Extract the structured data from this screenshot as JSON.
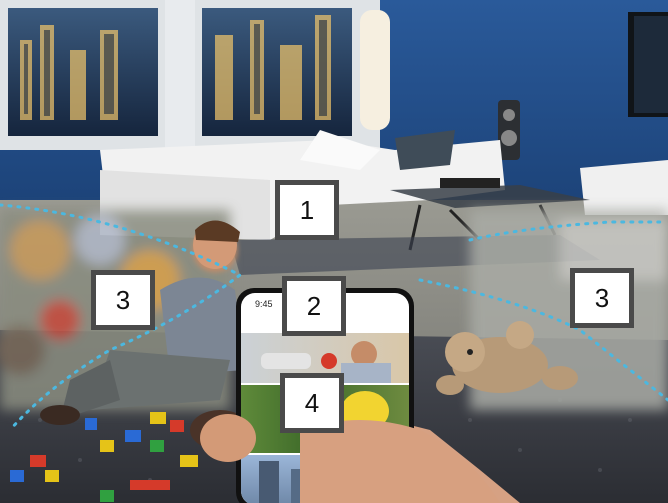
{
  "labels": {
    "one": "1",
    "two": "2",
    "three_left": "3",
    "three_right": "3",
    "four": "4"
  },
  "phone": {
    "time": "9:45"
  },
  "colors": {
    "label_border": "#4a4a4a",
    "label_fill": "#ffffff",
    "dotted_boundary": "#4bb8e0",
    "wall_blue": "#1f4f8c",
    "carpet": "#3c3f45"
  }
}
